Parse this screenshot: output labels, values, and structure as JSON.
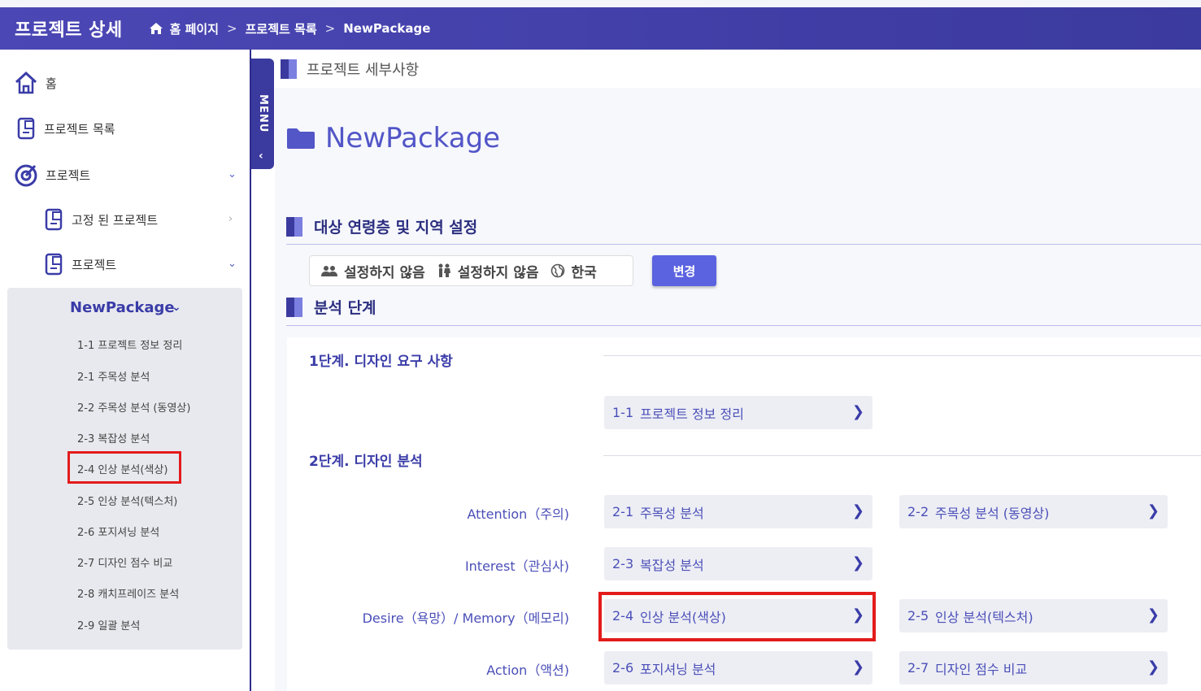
{
  "header": {
    "title": "프로젝트 상세",
    "breadcrumb": [
      "홈 페이지",
      "프로젝트 목록",
      "NewPackage"
    ],
    "separator": ">"
  },
  "sidebar": {
    "items": [
      {
        "label": "홈",
        "icon": "home-icon"
      },
      {
        "label": "프로젝트 목록",
        "icon": "document-icon"
      },
      {
        "label": "프로젝트",
        "icon": "target-icon"
      },
      {
        "label": "고정 된 프로젝트",
        "icon": "document-icon"
      },
      {
        "label": "프로젝트",
        "icon": "document-icon"
      }
    ],
    "package": {
      "name": "NewPackage",
      "items": [
        "1-1 프로젝트 정보 정리",
        "2-1 주목성 분석",
        "2-2 주목성 분석 (동영상)",
        "2-3 복잡성 분석",
        "2-4 인상 분석(색상)",
        "2-5 인상 분석(텍스처)",
        "2-6 포지셔닝 분석",
        "2-7 디자인 점수 비교",
        "2-8 캐치프레이즈 분석",
        "2-9 일괄 분석"
      ]
    }
  },
  "menu_tab": {
    "label": "MENU",
    "arrow": "‹"
  },
  "main": {
    "detail_label": "프로젝트 세부사항",
    "project_name": "NewPackage",
    "section_target": "대상 연령층 및 지역 설정",
    "filters": {
      "age": "설정하지 않음",
      "gender": "설정하지 않음",
      "region": "한국"
    },
    "change_button": "변경",
    "section_analysis": "분석 단계",
    "stage1": {
      "title": "1단계. 디자인 요구 사항",
      "cards": [
        {
          "num": "1-1",
          "label": "프로젝트 정보 정리"
        }
      ]
    },
    "stage2": {
      "title": "2단계. 디자인 분석",
      "rows": [
        {
          "label": "Attention（주의)",
          "cards": [
            {
              "num": "2-1",
              "label": "주목성 분석"
            },
            {
              "num": "2-2",
              "label": "주목성 분석 (동영상)"
            }
          ]
        },
        {
          "label": "Interest（관심사)",
          "cards": [
            {
              "num": "2-3",
              "label": "복잡성 분석"
            }
          ]
        },
        {
          "label": "Desire（욕망）/ Memory（메모리)",
          "cards": [
            {
              "num": "2-4",
              "label": "인상 분석(색상)"
            },
            {
              "num": "2-5",
              "label": "인상 분석(텍스처)"
            }
          ]
        },
        {
          "label": "Action（액션)",
          "cards": [
            {
              "num": "2-6",
              "label": "포지셔닝 분석"
            },
            {
              "num": "2-7",
              "label": "디자인 점수 비교"
            }
          ]
        }
      ]
    }
  },
  "colors": {
    "header": "#3b3a9e",
    "accent": "#5b63e0",
    "highlight": "#e31b1b"
  }
}
